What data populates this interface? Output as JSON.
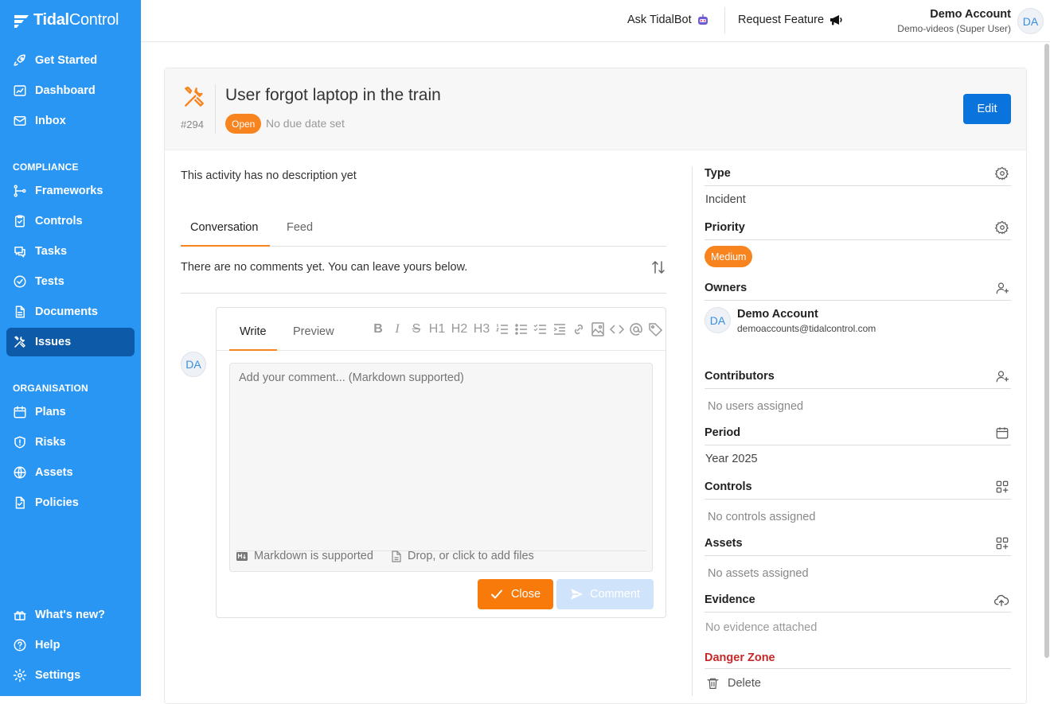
{
  "app": {
    "logo_text_bold": "Tidal",
    "logo_text_light": "Control"
  },
  "sidebar": {
    "top_items": [
      {
        "label": "Get Started",
        "icon": "rocket-icon"
      },
      {
        "label": "Dashboard",
        "icon": "dashboard-icon"
      },
      {
        "label": "Inbox",
        "icon": "mail-icon"
      }
    ],
    "compliance_label": "COMPLIANCE",
    "compliance_items": [
      {
        "label": "Frameworks",
        "icon": "frameworks-icon"
      },
      {
        "label": "Controls",
        "icon": "controls-icon"
      },
      {
        "label": "Tasks",
        "icon": "tasks-icon"
      },
      {
        "label": "Tests",
        "icon": "tests-icon"
      },
      {
        "label": "Documents",
        "icon": "documents-icon"
      },
      {
        "label": "Issues",
        "icon": "issues-icon",
        "active": true
      }
    ],
    "organisation_label": "ORGANISATION",
    "organisation_items": [
      {
        "label": "Plans",
        "icon": "calendar-icon"
      },
      {
        "label": "Risks",
        "icon": "shield-icon"
      },
      {
        "label": "Assets",
        "icon": "globe-icon"
      },
      {
        "label": "Policies",
        "icon": "policy-icon"
      }
    ],
    "bottom_items": [
      {
        "label": "What's new?",
        "icon": "gift-icon"
      },
      {
        "label": "Help",
        "icon": "help-icon"
      },
      {
        "label": "Settings",
        "icon": "gear-icon"
      }
    ]
  },
  "topbar": {
    "ask_bot": "Ask TidalBot",
    "request_feature": "Request Feature",
    "account_name": "Demo Account",
    "account_role": "Demo-videos (Super User)",
    "avatar_initials": "DA"
  },
  "issue": {
    "number": "#294",
    "title": "User forgot laptop in the train",
    "status": "Open",
    "due": "No due date set",
    "edit_label": "Edit",
    "description": "This activity has no description yet"
  },
  "conversation": {
    "tabs": [
      "Conversation",
      "Feed"
    ],
    "empty_text": "There are no comments yet. You can leave yours below.",
    "avatar_initials": "DA",
    "editor": {
      "tabs": [
        "Write",
        "Preview"
      ],
      "toolbar_text": [
        "H1",
        "H2",
        "H3"
      ],
      "placeholder": "Add your comment... (Markdown supported)",
      "markdown_note": "Markdown is supported",
      "files_note": "Drop, or click to add files",
      "close_label": "Close",
      "comment_label": "Comment"
    }
  },
  "details": {
    "type_label": "Type",
    "type_value": "Incident",
    "priority_label": "Priority",
    "priority_value": "Medium",
    "owners_label": "Owners",
    "owner_initials": "DA",
    "owner_name": "Demo Account",
    "owner_email": "demoaccounts@tidalcontrol.com",
    "contributors_label": "Contributors",
    "contributors_empty": "No users assigned",
    "period_label": "Period",
    "period_value": "Year 2025",
    "controls_label": "Controls",
    "controls_empty": "No controls assigned",
    "assets_label": "Assets",
    "assets_empty": "No assets assigned",
    "evidence_label": "Evidence",
    "evidence_empty": "No evidence attached",
    "danger_label": "Danger Zone",
    "delete_label": "Delete"
  },
  "colors": {
    "sidebar": "#2a96f3",
    "active_nav": "#0d5aa8",
    "accent_orange": "#f7841f",
    "primary_blue": "#0a74dc",
    "danger": "#c62828"
  }
}
